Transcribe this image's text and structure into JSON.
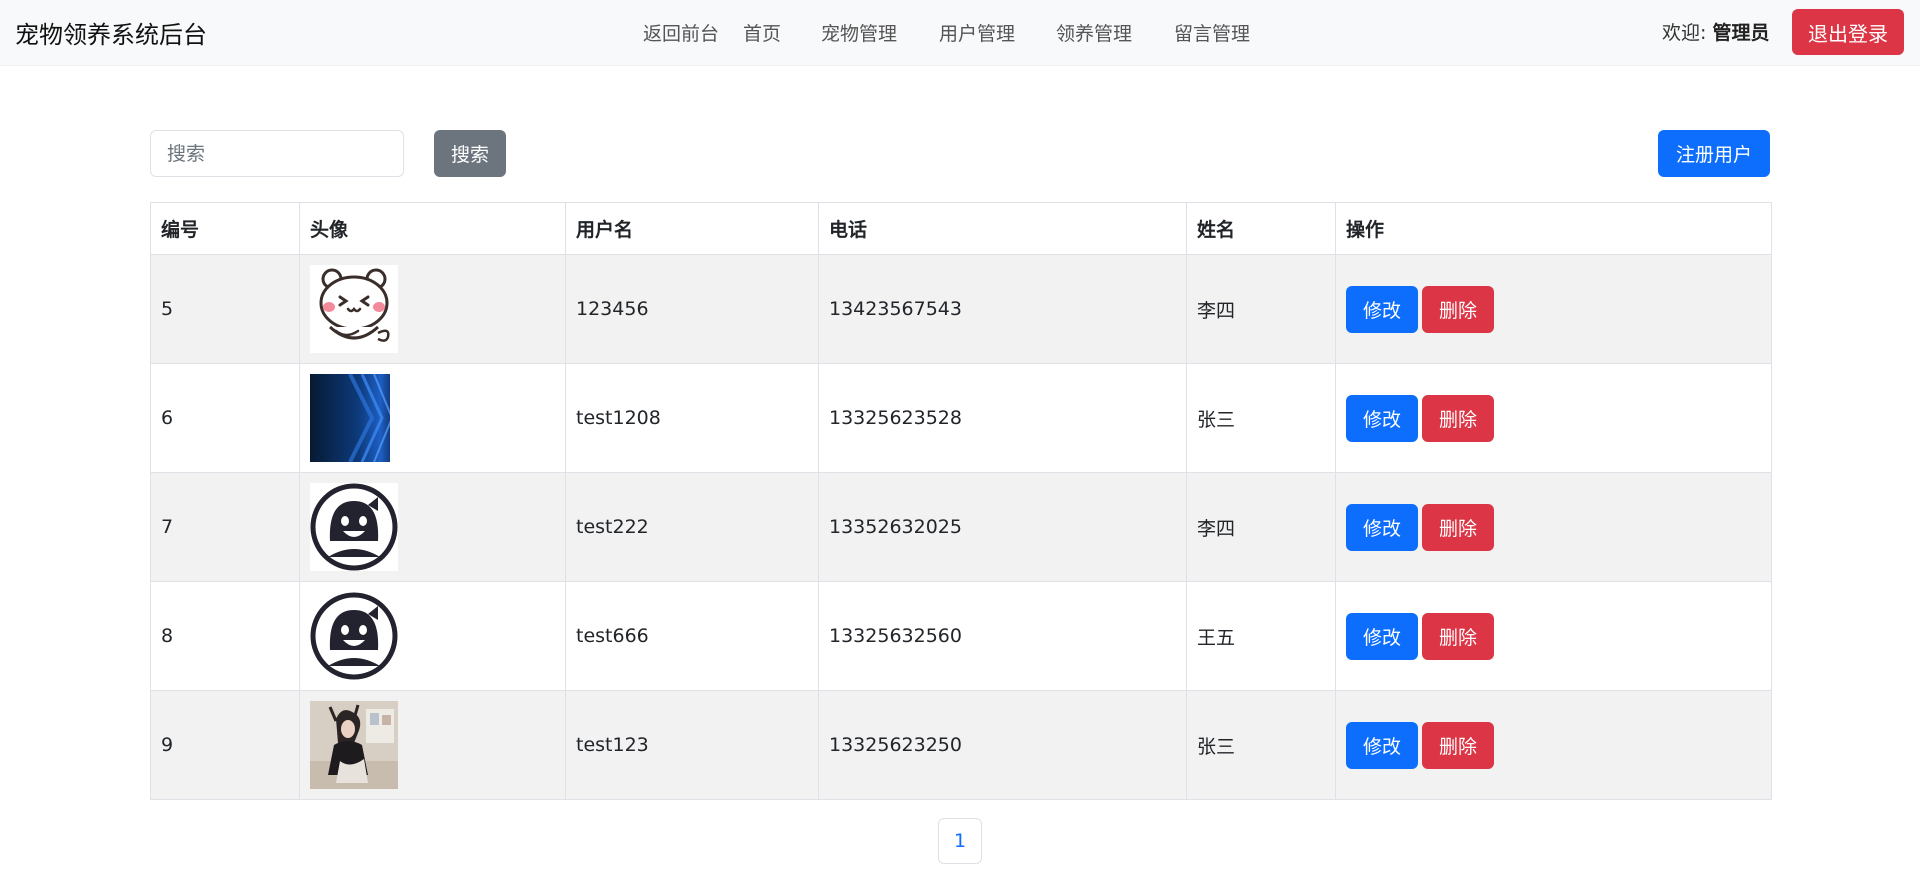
{
  "app": {
    "brand": "宠物领养系统后台"
  },
  "nav": [
    {
      "label": "返回前台"
    },
    {
      "label": "首页"
    },
    {
      "label": "宠物管理"
    },
    {
      "label": "用户管理"
    },
    {
      "label": "领养管理"
    },
    {
      "label": "留言管理"
    }
  ],
  "user": {
    "welcome_label": "欢迎:",
    "name": "管理员",
    "logout_label": "退出登录"
  },
  "toolbar": {
    "search_placeholder": "搜索",
    "search_label": "搜索",
    "register_label": "注册用户"
  },
  "table": {
    "headers": [
      "编号",
      "头像",
      "用户名",
      "电话",
      "姓名",
      "操作"
    ],
    "rows": [
      {
        "id": "5",
        "avatar": "cartoon-cat-avatar",
        "username": "123456",
        "phone": "13423567543",
        "name": "李四"
      },
      {
        "id": "6",
        "avatar": "blue-abstract-avatar",
        "username": "test1208",
        "phone": "13325623528",
        "name": "张三"
      },
      {
        "id": "7",
        "avatar": "smiley-face-avatar",
        "username": "test222",
        "phone": "13352632025",
        "name": "李四"
      },
      {
        "id": "8",
        "avatar": "smiley-face-avatar",
        "username": "test666",
        "phone": "13325632560",
        "name": "王五"
      },
      {
        "id": "9",
        "avatar": "photo-avatar",
        "username": "test123",
        "phone": "13325623250",
        "name": "张三"
      }
    ],
    "edit_label": "修改",
    "delete_label": "删除"
  },
  "pagination": {
    "current": "1"
  },
  "colors": {
    "primary": "#0d6efd",
    "danger": "#dc3545",
    "secondary": "#6c757d",
    "navbar_bg": "#f8f9fa",
    "stripe": "#f2f2f2"
  }
}
